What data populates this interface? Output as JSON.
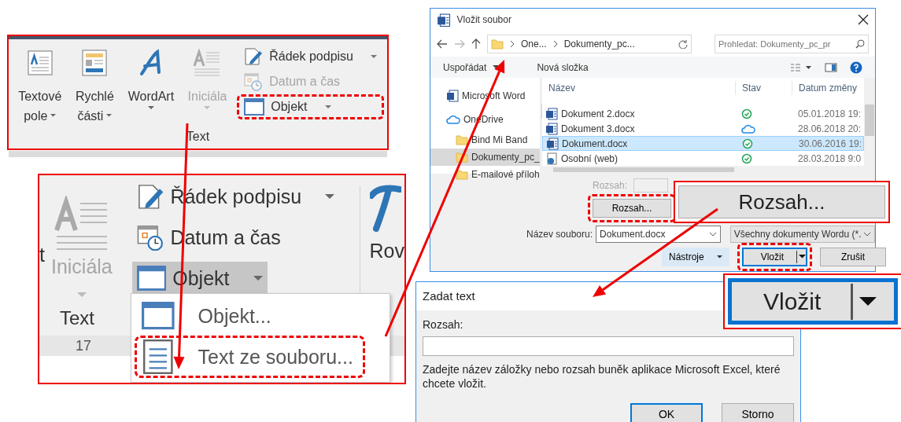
{
  "ribbon": {
    "large_buttons": [
      {
        "kind": "textbox",
        "lines": [
          "Textové",
          "pole"
        ],
        "disabled": false
      },
      {
        "kind": "quickparts",
        "lines": [
          "Rychlé",
          "části"
        ],
        "disabled": false
      },
      {
        "kind": "wordart",
        "lines": [
          "WordArt"
        ],
        "disabled": false
      },
      {
        "kind": "dropcap",
        "lines": [
          "Iniciála"
        ],
        "disabled": true
      }
    ],
    "small_buttons": [
      {
        "kind": "signature",
        "label": "Řádek podpisu",
        "dropdown": true,
        "disabled": false,
        "highlighted": false
      },
      {
        "kind": "datetime",
        "label": "Datum a čas",
        "dropdown": false,
        "disabled": true,
        "highlighted": false
      },
      {
        "kind": "object",
        "label": "Objekt",
        "dropdown": true,
        "disabled": false,
        "highlighted": true
      }
    ],
    "group_label": "Text"
  },
  "ribbon_zoom": {
    "cut_left": "t",
    "dropcap": {
      "label": "Iniciála",
      "disabled": true
    },
    "small_buttons": [
      {
        "kind": "signature",
        "label": "Řádek podpisu",
        "dropdown": true,
        "pressed": false
      },
      {
        "kind": "datetime",
        "label": "Datum a čas",
        "dropdown": false,
        "pressed": false
      },
      {
        "kind": "object",
        "label": "Objekt",
        "dropdown": true,
        "pressed": true
      }
    ],
    "cut_right": "Rov",
    "group_label": "Text",
    "ruler": "17",
    "menu": [
      {
        "kind": "object",
        "label": "Objekt...",
        "highlighted": false
      },
      {
        "kind": "textfile",
        "label": "Text ze souboru...",
        "highlighted": true
      }
    ]
  },
  "insert_dialog": {
    "title": "Vložit soubor",
    "path": [
      "One...",
      "Dokumenty_pc..."
    ],
    "search": {
      "placeholder": "Prohledat: Dokumenty_pc_pr"
    },
    "toolbar": [
      "Uspořádat",
      "Nová složka"
    ],
    "nav": [
      {
        "kind": "app",
        "label": "Microsoft Word",
        "selected": false
      },
      {
        "kind": "cloud",
        "label": "OneDrive",
        "selected": false
      },
      {
        "kind": "folder",
        "label": "Bind Mi Band",
        "selected": false
      },
      {
        "kind": "folder",
        "label": "Dokumenty_pc_",
        "selected": true
      },
      {
        "kind": "folder",
        "label": "E-mailové příloh",
        "selected": false
      }
    ],
    "columns": [
      "Název",
      "Stav",
      "Datum změny"
    ],
    "rows": [
      {
        "kind": "doc",
        "name": "Dokument 2.docx",
        "offline": true,
        "date": "05.01.2018 19:",
        "selected": false
      },
      {
        "kind": "doc",
        "name": "Dokument 3.docx",
        "offline": false,
        "date": "28.06.2018 20:",
        "selected": false
      },
      {
        "kind": "doc",
        "name": "Dokument.docx",
        "offline": true,
        "date": "30.06.2016 19:",
        "selected": true
      },
      {
        "kind": "web",
        "name": "Osobní (web)",
        "offline": true,
        "date": "28.03.2018 9:0",
        "selected": false
      }
    ],
    "range_label": "Rozsah:",
    "range_button": {
      "label": "Rozsah...",
      "highlighted": true
    },
    "filename_label": "Název souboru:",
    "filename": "Dokument.docx",
    "filter": "Všechny dokumenty Wordu (*.",
    "buttons": [
      {
        "kind": "tools",
        "label": "Nástroje",
        "highlighted": false
      },
      {
        "kind": "split",
        "label": "Vložit",
        "highlighted": true
      },
      {
        "kind": "plain",
        "label": "Zrušit",
        "highlighted": false
      }
    ]
  },
  "range_callout": {
    "label": "Rozsah..."
  },
  "insert_callout": {
    "label": "Vložit"
  },
  "text_dialog": {
    "title": "Zadat text",
    "field_label": "Rozsah:",
    "hint": "Zadejte název záložky nebo rozsah buněk aplikace Microsoft Excel, které chcete vložit.",
    "buttons": [
      {
        "label": "OK",
        "default": true
      },
      {
        "label": "Storno",
        "default": false
      }
    ]
  }
}
